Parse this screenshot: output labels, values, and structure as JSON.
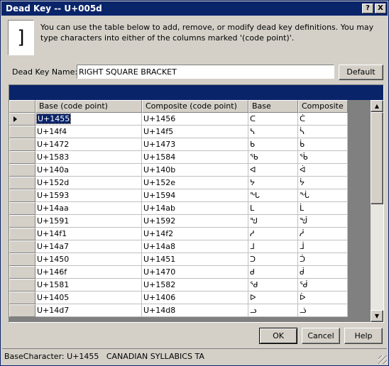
{
  "window": {
    "title": "Dead Key -- U+005d",
    "help_glyph": "?",
    "close_glyph": "X"
  },
  "glyph": "]",
  "intro_text": "You can use the table below to add, remove, or modify dead key definitions.  You may type characters into either of the columns marked '(code point)'.",
  "dead_key": {
    "label": "Dead Key Name:",
    "value": "RIGHT SQUARE BRACKET",
    "default_label": "Default"
  },
  "table": {
    "columns": [
      "Base  (code point)",
      "Composite  (code point)",
      "Base",
      "Composite"
    ],
    "rows": [
      {
        "base_cp": "U+1455",
        "comp_cp": "U+1456",
        "base": "ᑕ",
        "comp": "ᑖ"
      },
      {
        "base_cp": "U+14f4",
        "comp_cp": "U+14f5",
        "base": "ᓴ",
        "comp": "ᓵ"
      },
      {
        "base_cp": "U+1472",
        "comp_cp": "U+1473",
        "base": "ᑲ",
        "comp": "ᑳ"
      },
      {
        "base_cp": "U+1583",
        "comp_cp": "U+1584",
        "base": "ᖃ",
        "comp": "ᖄ"
      },
      {
        "base_cp": "U+140a",
        "comp_cp": "U+140b",
        "base": "ᐊ",
        "comp": "ᐋ"
      },
      {
        "base_cp": "U+152d",
        "comp_cp": "U+152e",
        "base": "ᔭ",
        "comp": "ᔮ"
      },
      {
        "base_cp": "U+1593",
        "comp_cp": "U+1594",
        "base": "ᖓ",
        "comp": "ᖔ"
      },
      {
        "base_cp": "U+14aa",
        "comp_cp": "U+14ab",
        "base": "ᒪ",
        "comp": "ᒫ"
      },
      {
        "base_cp": "U+1591",
        "comp_cp": "U+1592",
        "base": "ᖑ",
        "comp": "ᖒ"
      },
      {
        "base_cp": "U+14f1",
        "comp_cp": "U+14f2",
        "base": "ᓱ",
        "comp": "ᓲ"
      },
      {
        "base_cp": "U+14a7",
        "comp_cp": "U+14a8",
        "base": "ᒧ",
        "comp": "ᒨ"
      },
      {
        "base_cp": "U+1450",
        "comp_cp": "U+1451",
        "base": "ᑐ",
        "comp": "ᑑ"
      },
      {
        "base_cp": "U+146f",
        "comp_cp": "U+1470",
        "base": "ᑯ",
        "comp": "ᑰ"
      },
      {
        "base_cp": "U+1581",
        "comp_cp": "U+1582",
        "base": "ᖁ",
        "comp": "ᖂ"
      },
      {
        "base_cp": "U+1405",
        "comp_cp": "U+1406",
        "base": "ᐅ",
        "comp": "ᐆ"
      },
      {
        "base_cp": "U+14d7",
        "comp_cp": "U+14d8",
        "base": "ᓗ",
        "comp": "ᓘ"
      }
    ]
  },
  "buttons": {
    "ok": "OK",
    "cancel": "Cancel",
    "help": "Help"
  },
  "status": "BaseCharacter: U+1455   CANADIAN SYLLABICS TA",
  "colors": {
    "titlebar": "#0a246a",
    "face": "#d4d0c8",
    "selection": "#0a246a"
  }
}
